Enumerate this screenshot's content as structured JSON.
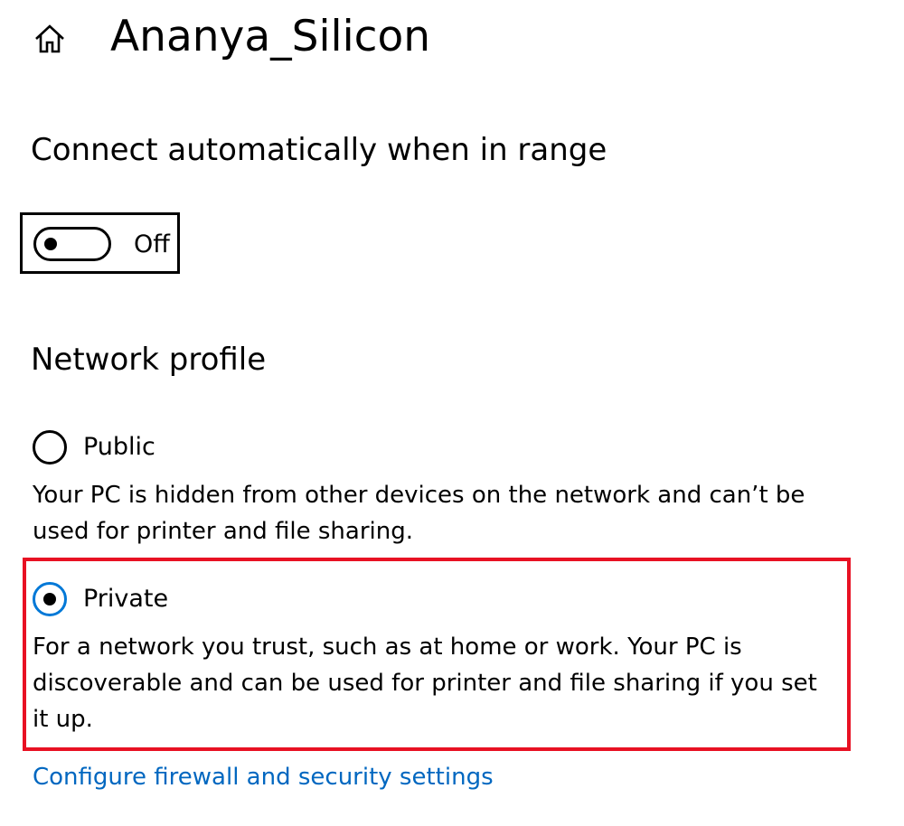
{
  "header": {
    "title": "Ananya_Silicon",
    "home_icon": "home-icon"
  },
  "connect_auto": {
    "heading": "Connect automatically when in range",
    "toggle_state_label": "Off",
    "toggle_on": false
  },
  "network_profile": {
    "heading": "Network profile",
    "options": [
      {
        "label": "Public",
        "description": "Your PC is hidden from other devices on the network and can’t be used for printer and file sharing.",
        "selected": false
      },
      {
        "label": "Private",
        "description": "For a network you trust, such as at home or work. Your PC is discoverable and can be used for printer and file sharing if you set it up.",
        "selected": true
      }
    ],
    "highlight_color": "#e81123",
    "selected_radio_color": "#0078d7"
  },
  "links": {
    "firewall": "Configure firewall and security settings",
    "link_color": "#0067c0"
  }
}
